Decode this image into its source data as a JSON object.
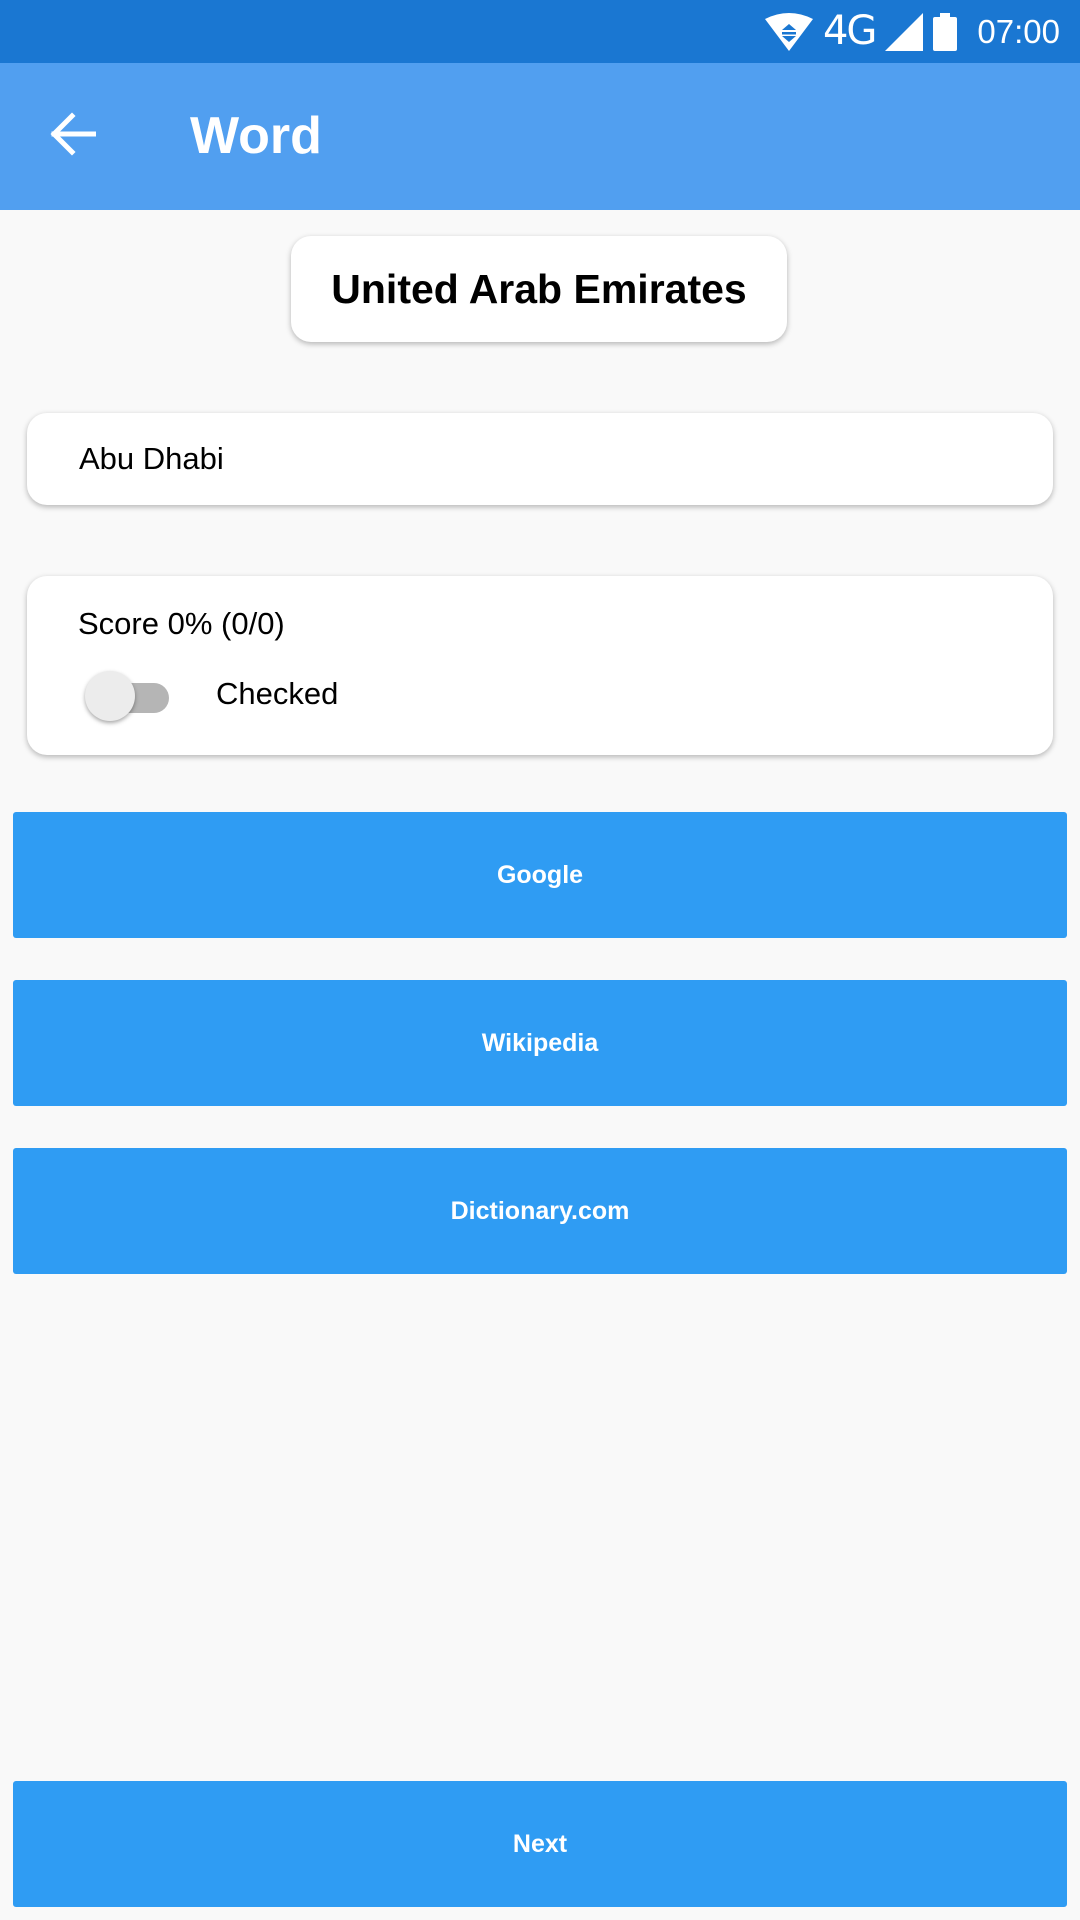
{
  "status_bar": {
    "network": "4G",
    "time": "07:00",
    "icons": [
      "wifi-icon",
      "signal-icon",
      "battery-icon"
    ]
  },
  "app_bar": {
    "title": "Word",
    "back_icon": "arrow-left-icon"
  },
  "word": {
    "text": "United Arab Emirates"
  },
  "answer": {
    "value": "Abu Dhabi"
  },
  "score": {
    "text": "Score 0% (0/0)",
    "switch_label": "Checked",
    "switch_on": false
  },
  "buttons": {
    "google": "Google",
    "wikipedia": "Wikipedia",
    "dictionary": "Dictionary.com",
    "next": "Next"
  },
  "colors": {
    "status_bar": "#1a77d2",
    "app_bar": "#519ff0",
    "button": "#2f9cf3",
    "background": "#f9f9f9"
  }
}
